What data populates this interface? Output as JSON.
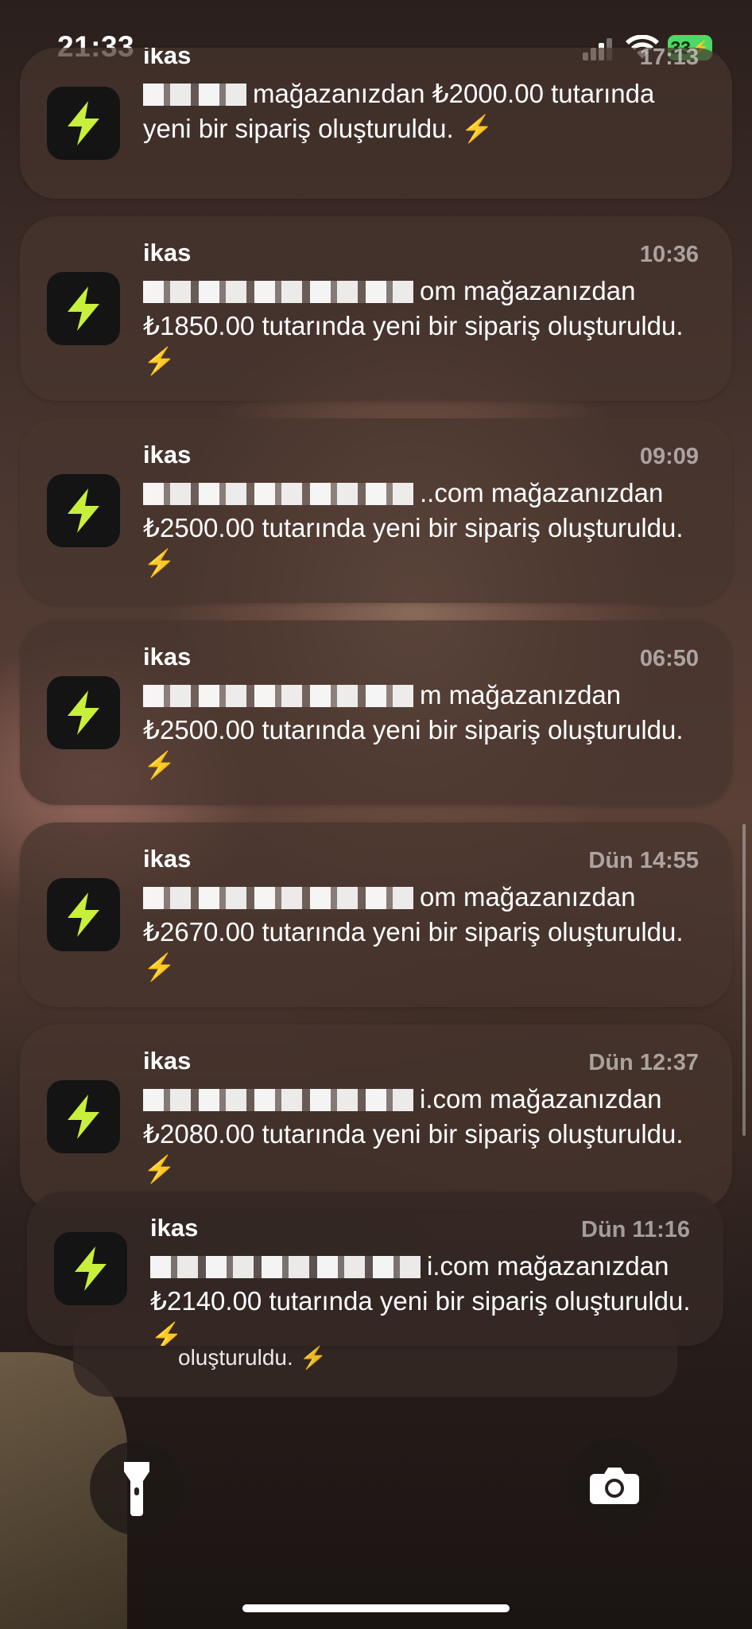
{
  "status_bar": {
    "time": "21:33",
    "battery": "33"
  },
  "notifications": [
    {
      "app": "ikas",
      "time": "17:13",
      "redacted_prefix": "",
      "text": "mağazanızdan ₺2000.00 tutarında yeni bir sipariş oluşturuldu. ⚡"
    },
    {
      "app": "ikas",
      "time": "10:36",
      "redacted_prefix": "",
      "text": "om mağazanızdan ₺1850.00 tutarında yeni bir sipariş oluşturuldu. ⚡"
    },
    {
      "app": "ikas",
      "time": "09:09",
      "redacted_prefix": "",
      "text": "..com mağazanızdan ₺2500.00 tutarında yeni bir sipariş oluşturuldu. ⚡"
    },
    {
      "app": "ikas",
      "time": "06:50",
      "redacted_prefix": "",
      "text": "m mağazanızdan ₺2500.00 tutarında yeni bir sipariş oluşturuldu. ⚡"
    },
    {
      "app": "ikas",
      "time": "Dün 14:55",
      "redacted_prefix": "",
      "text": "om mağazanızdan ₺2670.00 tutarında yeni bir sipariş oluşturuldu. ⚡"
    },
    {
      "app": "ikas",
      "time": "Dün 12:37",
      "redacted_prefix": "",
      "text": "i.com mağazanızdan ₺2080.00 tutarında yeni bir sipariş oluşturuldu. ⚡"
    },
    {
      "app": "ikas",
      "time": "Dün 11:16",
      "redacted_prefix": "",
      "text": "i.com mağazanızdan ₺2140.00 tutarında yeni bir sipariş oluşturuldu. ⚡"
    }
  ],
  "stack_tail": {
    "text": "oluşturuldu. ⚡"
  },
  "buttons": {
    "flashlight": "flashlight-icon",
    "camera": "camera-icon"
  },
  "colors": {
    "app_icon_bg": "#141414",
    "app_icon_bolt": "#c8f03a",
    "battery": "#4cd964"
  }
}
